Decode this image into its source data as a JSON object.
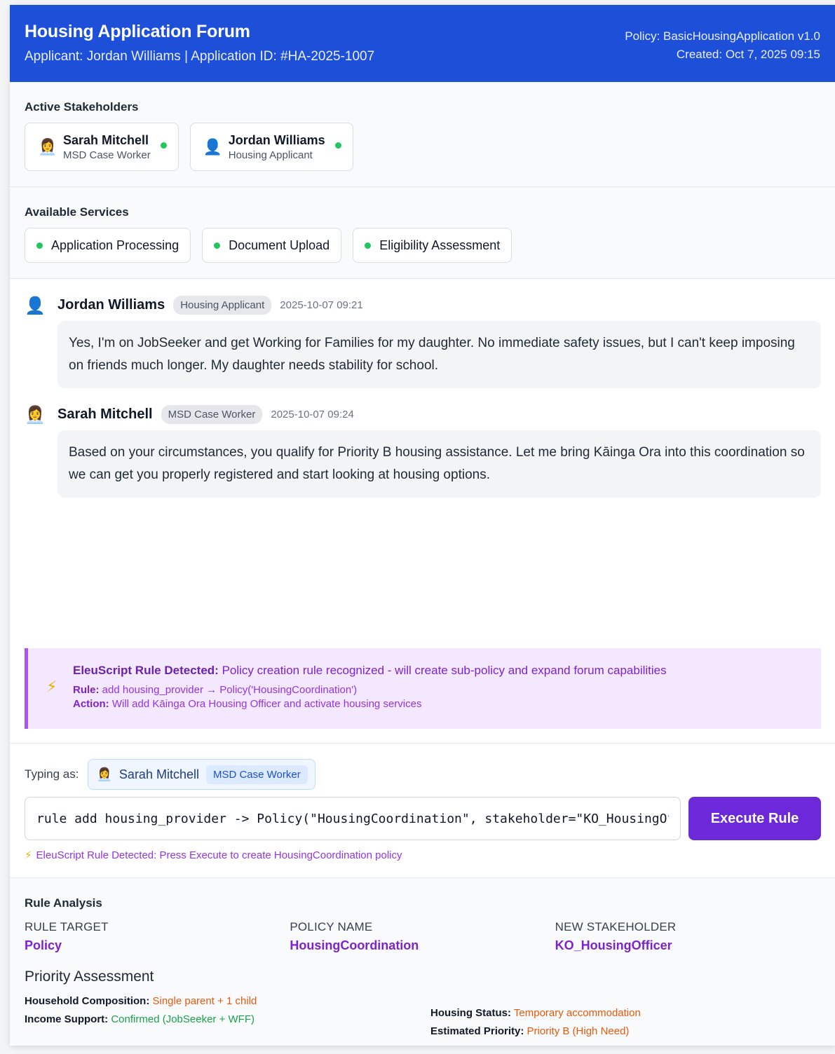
{
  "header": {
    "title": "Housing Application Forum",
    "subtitle": "Applicant: Jordan Williams | Application ID: #HA-2025-1007",
    "policy": "Policy: BasicHousingApplication v1.0",
    "created": "Created: Oct 7, 2025 09:15"
  },
  "stakeholders": {
    "title": "Active Stakeholders",
    "items": [
      {
        "icon": "👩‍💼",
        "name": "Sarah Mitchell",
        "role": "MSD Case Worker"
      },
      {
        "icon": "👤",
        "name": "Jordan Williams",
        "role": "Housing Applicant"
      }
    ]
  },
  "services": {
    "title": "Available Services",
    "items": [
      "Application Processing",
      "Document Upload",
      "Eligibility Assessment"
    ]
  },
  "messages": [
    {
      "icon": "👤",
      "name": "Jordan Williams",
      "role": "Housing Applicant",
      "time": "2025-10-07 09:21",
      "text": "Yes, I'm on JobSeeker and get Working for Families for my daughter. No immediate safety issues, but I can't keep imposing on friends much longer. My daughter needs stability for school."
    },
    {
      "icon": "👩‍💼",
      "name": "Sarah Mitchell",
      "role": "MSD Case Worker",
      "time": "2025-10-07 09:24",
      "text": "Based on your circumstances, you qualify for Priority B housing assistance. Let me bring Kāinga Ora into this coordination so we can get you properly registered and start looking at housing options."
    }
  ],
  "rule_notice": {
    "icon": "⚡",
    "heading": "EleuScript Rule Detected:",
    "description": "Policy creation rule recognized - will create sub-policy and expand forum capabilities",
    "rule_label": "Rule:",
    "rule_value": "add housing_provider → Policy('HousingCoordination')",
    "action_label": "Action:",
    "action_value": "Will add Kāinga Ora Housing Officer and activate housing services"
  },
  "composer": {
    "typing_label": "Typing as:",
    "user_icon": "👩‍💼",
    "user_name": "Sarah Mitchell",
    "user_role": "MSD Case Worker",
    "input_value": "rule add housing_provider -> Policy(\"HousingCoordination\", stakeholder=\"KO_HousingOfficer\")",
    "execute_label": "Execute Rule",
    "hint_icon": "⚡",
    "hint": "EleuScript Rule Detected: Press Execute to create HousingCoordination policy"
  },
  "analysis": {
    "title": "Rule Analysis",
    "fields": [
      {
        "key": "RULE TARGET",
        "value": "Policy"
      },
      {
        "key": "POLICY NAME",
        "value": "HousingCoordination"
      },
      {
        "key": "NEW STAKEHOLDER",
        "value": "KO_HousingOfficer"
      }
    ],
    "priority_title": "Priority Assessment",
    "household_label": "Household Composition:",
    "household_value": "Single parent + 1 child",
    "income_label": "Income Support:",
    "income_value": "Confirmed (JobSeeker + WFF)",
    "housing_label": "Housing Status:",
    "housing_value": "Temporary accommodation",
    "priority_label": "Estimated Priority:",
    "priority_value": "Priority B (High Need)"
  },
  "colors": {
    "header": "#1d4fd8",
    "accent_purple": "#6d28d9",
    "online": "#22c55e",
    "warning": "#ea580c",
    "success": "#16a34a"
  }
}
